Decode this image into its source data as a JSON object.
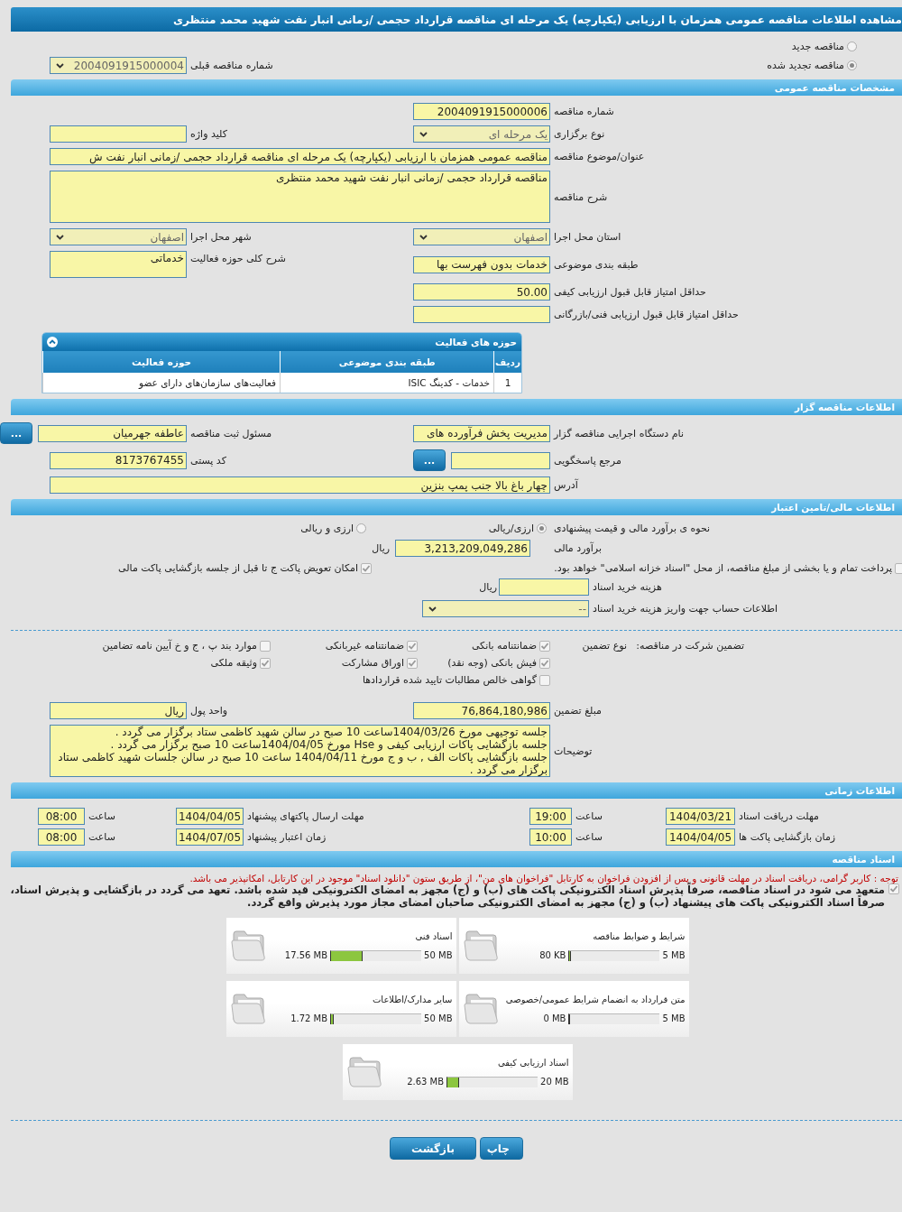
{
  "window": {
    "title": "مشاهده اطلاعات مناقصه عمومی همزمان با ارزیابی (یکپارچه) یک مرحله ای مناقصه قرارداد حجمی /زمانی انبار نفت شهید محمد منتظری"
  },
  "tender_status": [
    {
      "label": "مناقصه جدید",
      "selected": false
    },
    {
      "label": "مناقصه تجدید شده",
      "selected": true
    }
  ],
  "previous_tender": {
    "label": "شماره مناقصه قبلی",
    "value": "2004091915000004"
  },
  "general": {
    "title": "مشخصات مناقصه عمومی",
    "rows": [
      [
        {
          "kind": "text",
          "label": "شماره مناقصه",
          "value": "2004091915000006"
        }
      ],
      [
        {
          "kind": "select",
          "label": "نوع برگزاری",
          "value": "یک مرحله ای"
        },
        {
          "kind": "text",
          "label": "کلید واژه"
        }
      ],
      [
        {
          "kind": "wide",
          "label": "عنوان/موضوع مناقصه",
          "value": "مناقصه عمومی همزمان با ارزیابی (یکپارچه) یک مرحله ای مناقصه قرارداد حجمی /زمانی انبار نفت ش"
        }
      ],
      [
        {
          "kind": "wide_area",
          "label": "شرح مناقصه",
          "value": "مناقصه قرارداد حجمی /زمانی انبار نفت شهید محمد منتظری"
        }
      ],
      [
        {
          "kind": "select",
          "label": "استان محل اجرا",
          "value": "اصفهان"
        },
        {
          "kind": "select",
          "label": "شهر محل اجرا",
          "value": "اصفهان"
        }
      ],
      [
        {
          "kind": "text",
          "label": "طبقه بندی موضوعی",
          "value": "خدمات بدون فهرست بها"
        },
        {
          "kind": "area",
          "label": "شرح کلی حوزه فعالیت",
          "value": "خدماتی"
        }
      ],
      [
        {
          "kind": "text",
          "label": "حداقل امتیاز قابل قبول ارزیابی کیفی",
          "value": "50.00"
        }
      ],
      [
        {
          "kind": "text",
          "label": "حداقل امتیاز قابل قبول ارزیابی فنی/بازرگانی"
        }
      ]
    ],
    "activities": {
      "title": "حوزه های فعالیت",
      "expanded": true,
      "columns": [
        "ردیف",
        "طبقه بندی موضوعی",
        "حوزه فعالیت"
      ],
      "rows": [
        [
          "1",
          "خدمات - کدینگ ISIC",
          "فعالیت‌های سازمان‌های دارای عضو"
        ]
      ]
    }
  },
  "issuer": {
    "title": "اطلاعات مناقصه گزار",
    "rows": [
      [
        {
          "kind": "text",
          "label": "نام دستگاه اجرایی مناقصه گزار",
          "value": "مدیریت پخش فرآورده های"
        },
        {
          "kind": "text",
          "label": "مسئول ثبت مناقصه",
          "value": "عاطفه جهرمیان",
          "button": "..."
        }
      ],
      [
        {
          "kind": "text",
          "label": "مرجع پاسخگویی",
          "button": "..."
        },
        {
          "kind": "text",
          "label": "کد پستی",
          "value": "8173767455"
        }
      ],
      [
        {
          "kind": "wide",
          "label": "آدرس",
          "value": "چهار باغ بالا جنب پمپ بنزین"
        }
      ]
    ]
  },
  "finance": {
    "title": "اطلاعات مالی/تامین اعتبار",
    "estimate_method": {
      "label": "نحوه ی برآورد مالی و قیمت پیشنهادی",
      "options": [
        {
          "label": "ارزی/ریالی",
          "selected": true
        },
        {
          "label": "ارزی و ریالی",
          "selected": false
        }
      ]
    },
    "estimate": {
      "label": "برآورد مالی",
      "value": "3,213,209,049,286",
      "unit": "ریال"
    },
    "options": [
      {
        "label": "پرداخت تمام و یا بخشی از مبلغ مناقصه، از محل \"اسناد خزانه اسلامی\" خواهد بود.",
        "checked": false
      },
      {
        "label": "امکان تعویض پاکت ج تا قبل از جلسه بازگشایی پاکت مالی",
        "checked": true
      }
    ],
    "doc_fee": {
      "label": "هزینه خرید اسناد",
      "unit": "ریال"
    },
    "account": {
      "label": "اطلاعات حساب جهت واریز هزینه خرید اسناد",
      "value": "--"
    },
    "guarantee": {
      "label": "تضمین شرکت در مناقصه:",
      "type_label": "نوع تضمین",
      "types": [
        {
          "label": "ضمانتنامه بانکی",
          "checked": true
        },
        {
          "label": "ضمانتنامه غیربانکی",
          "checked": true
        },
        {
          "label": "موارد بند پ ، ج و خ آیین نامه تضامین",
          "checked": false
        },
        {
          "label": "فیش بانکی (وجه نقد)",
          "checked": true
        },
        {
          "label": "اوراق مشارکت",
          "checked": true
        },
        {
          "label": "وثیقه ملکی",
          "checked": true
        },
        {
          "label": "گواهی خالص مطالبات تایید شده قراردادها",
          "checked": false
        }
      ]
    },
    "amount_rows": [
      [
        {
          "kind": "text",
          "label": "مبلغ تضمین",
          "value": "76,864,180,986"
        },
        {
          "kind": "text",
          "label": "واحد پول",
          "value": "ریال"
        }
      ],
      [
        {
          "kind": "wide_area",
          "label": "توضیحات",
          "value": "جلسه توجیهی مورخ 1404/03/26ساعت 10 صبح در سالن شهید کاظمی ستاد برگزار می گردد .\nجلسه بازگشایی پاکات ارزیابی کیفی و Hse مورخ 1404/04/05ساعت 10 صبح برگزار می گردد .\nجلسه بازگشایی پاکات الف , ب و ج مورخ 1404/04/11 ساعت 10 صبح در سالن جلسات شهید کاظمی ستاد برگزار می گردد ."
        }
      ]
    ]
  },
  "timing": {
    "title": "اطلاعات زمانی",
    "rows": [
      [
        {
          "label": "مهلت دریافت اسناد",
          "date": "1404/03/21",
          "time_label": "ساعت",
          "time": "19:00"
        },
        {
          "label": "مهلت ارسال پاکتهای پیشنهاد",
          "date": "1404/04/05",
          "time_label": "ساعت",
          "time": "08:00"
        }
      ],
      [
        {
          "label": "زمان بازگشایی پاکت ها",
          "date": "1404/04/05",
          "time_label": "ساعت",
          "time": "10:00"
        },
        {
          "label": "زمان اعتبار پیشنهاد",
          "date": "1404/07/05",
          "time_label": "ساعت",
          "time": "08:00"
        }
      ]
    ]
  },
  "documents": {
    "title": "اسناد مناقصه",
    "notice": "توجه : کاربر گرامی، دریافت اسناد در مهلت قانونی و پس از افزودن فراخوان به کارتابل \"فراخوان های من\"، از طریق ستون \"دانلود اسناد\" موجود در این کارتابل، امکانپذیر می باشد.",
    "commitment": {
      "text": "متعهد می شود در اسناد مناقصه، صرفاً پذیرش اسناد الکترونیکی پاکت های (ب) و (ج) مجهز به امضای الکترونیکی قید شده باشد. تعهد می گردد در بازگشایی و پذیرش اسناد، صرفاً اسناد الکترونیکی پاکت های پیشنهاد (ب) و (ج) مجهز به امضای الکترونیکی صاحبان امضای مجاز مورد پذیرش واقع گردد.",
      "checked": true
    },
    "files": [
      {
        "name": "شرایط و ضوابط مناقصه",
        "max": "5 MB",
        "used": "80 KB",
        "level": 0.016
      },
      {
        "name": "اسناد فنی",
        "max": "50 MB",
        "used": "17.56 MB",
        "level": 0.35
      },
      {
        "name": "متن قرارداد به انضمام شرایط عمومی/خصوصی",
        "max": "5 MB",
        "used": "0 MB",
        "level": 0
      },
      {
        "name": "سایر مدارک/اطلاعات",
        "max": "50 MB",
        "used": "1.72 MB",
        "level": 0.034
      },
      {
        "name": "اسناد ارزیابی کیفی",
        "max": "20 MB",
        "used": "2.63 MB",
        "level": 0.13
      }
    ]
  },
  "buttons": [
    {
      "kind": "print",
      "label": "چاپ"
    },
    {
      "kind": "back",
      "label": "بازگشت"
    }
  ]
}
